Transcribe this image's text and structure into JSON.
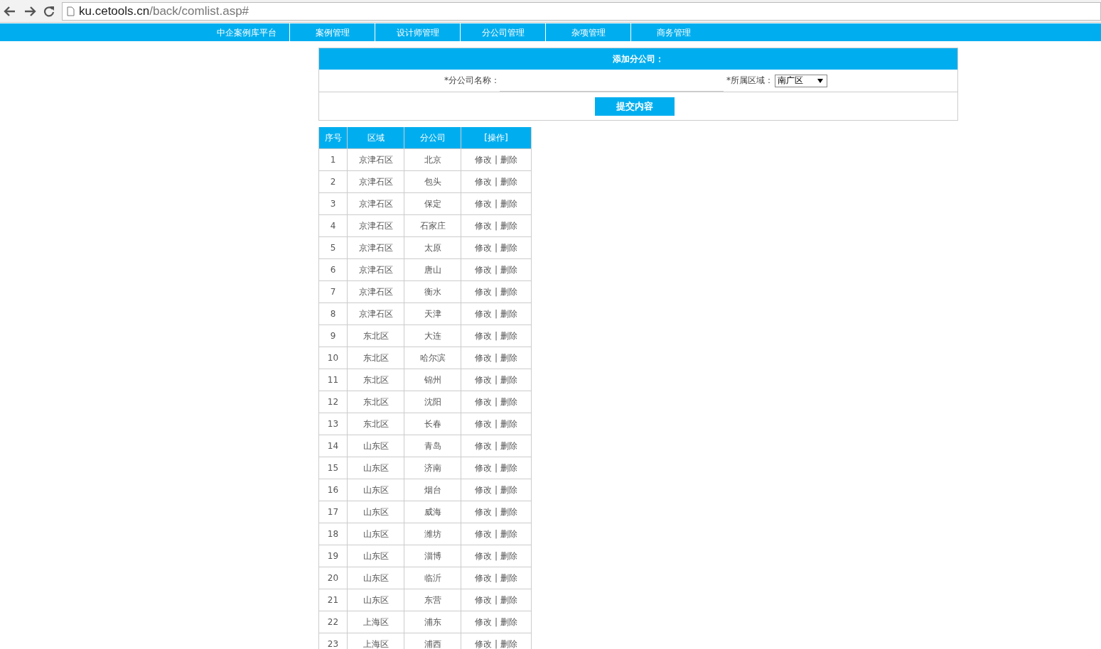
{
  "browser": {
    "url_host": "ku.cetools.cn",
    "url_path": "/back/comlist.asp#"
  },
  "nav": {
    "brand": "中企案例库平台",
    "items": [
      "案例管理",
      "设计师管理",
      "分公司管理",
      "杂项管理",
      "商务管理"
    ]
  },
  "form": {
    "title": "添加分公司：",
    "name_label": "*分公司名称：",
    "region_label": "*所属区域：",
    "region_value": "南广区",
    "submit": "提交内容"
  },
  "table": {
    "columns": [
      "序号",
      "区域",
      "分公司",
      "[操作]"
    ],
    "rows": [
      {
        "no": "1",
        "region": "京津石区",
        "branch": "北京",
        "edit": "修改",
        "sep": "|",
        "delete": "删除"
      },
      {
        "no": "2",
        "region": "京津石区",
        "branch": "包头",
        "edit": "修改",
        "sep": "|",
        "delete": "删除"
      },
      {
        "no": "3",
        "region": "京津石区",
        "branch": "保定",
        "edit": "修改",
        "sep": "|",
        "delete": "删除"
      },
      {
        "no": "4",
        "region": "京津石区",
        "branch": "石家庄",
        "edit": "修改",
        "sep": "|",
        "delete": "删除"
      },
      {
        "no": "5",
        "region": "京津石区",
        "branch": "太原",
        "edit": "修改",
        "sep": "|",
        "delete": "删除"
      },
      {
        "no": "6",
        "region": "京津石区",
        "branch": "唐山",
        "edit": "修改",
        "sep": "|",
        "delete": "删除"
      },
      {
        "no": "7",
        "region": "京津石区",
        "branch": "衡水",
        "edit": "修改",
        "sep": "|",
        "delete": "删除"
      },
      {
        "no": "8",
        "region": "京津石区",
        "branch": "天津",
        "edit": "修改",
        "sep": "|",
        "delete": "删除"
      },
      {
        "no": "9",
        "region": "东北区",
        "branch": "大连",
        "edit": "修改",
        "sep": "|",
        "delete": "删除"
      },
      {
        "no": "10",
        "region": "东北区",
        "branch": "哈尔滨",
        "edit": "修改",
        "sep": "|",
        "delete": "删除"
      },
      {
        "no": "11",
        "region": "东北区",
        "branch": "锦州",
        "edit": "修改",
        "sep": "|",
        "delete": "删除"
      },
      {
        "no": "12",
        "region": "东北区",
        "branch": "沈阳",
        "edit": "修改",
        "sep": "|",
        "delete": "删除"
      },
      {
        "no": "13",
        "region": "东北区",
        "branch": "长春",
        "edit": "修改",
        "sep": "|",
        "delete": "删除"
      },
      {
        "no": "14",
        "region": "山东区",
        "branch": "青岛",
        "edit": "修改",
        "sep": "|",
        "delete": "删除"
      },
      {
        "no": "15",
        "region": "山东区",
        "branch": "济南",
        "edit": "修改",
        "sep": "|",
        "delete": "删除"
      },
      {
        "no": "16",
        "region": "山东区",
        "branch": "烟台",
        "edit": "修改",
        "sep": "|",
        "delete": "删除"
      },
      {
        "no": "17",
        "region": "山东区",
        "branch": "威海",
        "edit": "修改",
        "sep": "|",
        "delete": "删除"
      },
      {
        "no": "18",
        "region": "山东区",
        "branch": "潍坊",
        "edit": "修改",
        "sep": "|",
        "delete": "删除"
      },
      {
        "no": "19",
        "region": "山东区",
        "branch": "淄博",
        "edit": "修改",
        "sep": "|",
        "delete": "删除"
      },
      {
        "no": "20",
        "region": "山东区",
        "branch": "临沂",
        "edit": "修改",
        "sep": "|",
        "delete": "删除"
      },
      {
        "no": "21",
        "region": "山东区",
        "branch": "东营",
        "edit": "修改",
        "sep": "|",
        "delete": "删除"
      },
      {
        "no": "22",
        "region": "上海区",
        "branch": "浦东",
        "edit": "修改",
        "sep": "|",
        "delete": "删除"
      },
      {
        "no": "23",
        "region": "上海区",
        "branch": "浦西",
        "edit": "修改",
        "sep": "|",
        "delete": "删除"
      }
    ]
  }
}
